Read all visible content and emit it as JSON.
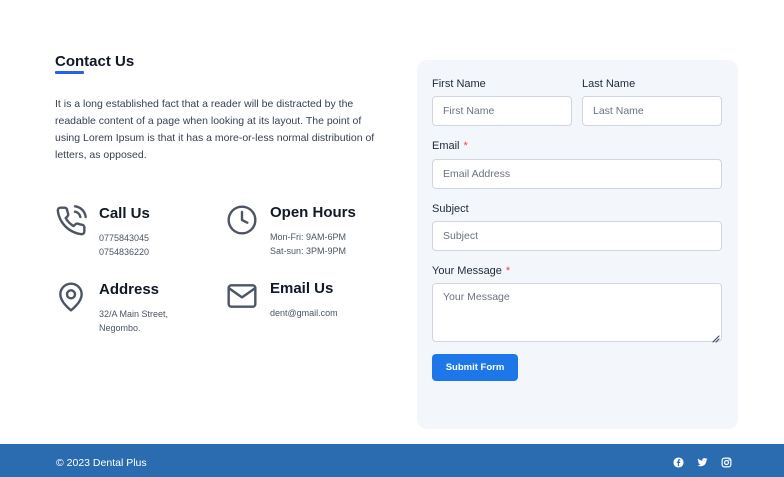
{
  "contact": {
    "title": "Contact Us",
    "intro": "It is a long established fact that a reader will be distracted by the readable content of a page when looking at its layout. The point of using Lorem Ipsum is that it has a more-or-less normal distribution of letters, as opposed."
  },
  "info": {
    "call": {
      "icon": "phone-icon",
      "title": "Call Us",
      "lines": [
        "0775843045",
        "0754836220"
      ]
    },
    "hours": {
      "icon": "clock-icon",
      "title": "Open Hours",
      "lines": [
        "Mon-Fri: 9AM-6PM",
        "Sat-sun: 3PM-9PM"
      ]
    },
    "address": {
      "icon": "location-pin-icon",
      "title": "Address",
      "lines": [
        "32/A Main Street,",
        "Negombo."
      ]
    },
    "email": {
      "icon": "envelope-icon",
      "title": "Email Us",
      "lines": [
        "dent@gmail.com"
      ]
    }
  },
  "form": {
    "first_name": {
      "label": "First Name",
      "placeholder": "First Name",
      "value": ""
    },
    "last_name": {
      "label": "Last Name",
      "placeholder": "Last Name",
      "value": ""
    },
    "email": {
      "label": "Email",
      "required_mark": "*",
      "placeholder": "Email Address",
      "value": ""
    },
    "subject": {
      "label": "Subject",
      "placeholder": "Subject",
      "value": ""
    },
    "message": {
      "label": "Your Message",
      "required_mark": "*",
      "placeholder": "Your Message",
      "value": ""
    },
    "submit_label": "Submit Form"
  },
  "footer": {
    "copyright": "© 2023 Dental Plus",
    "social": [
      "facebook-icon",
      "twitter-icon",
      "instagram-icon"
    ]
  },
  "colors": {
    "accent": "#2563eb",
    "button": "#1d77e8",
    "footer_bg": "#2b6cb0",
    "form_bg": "#f3f6fb",
    "icon_stroke": "#4b5563",
    "required": "#ef4444"
  }
}
